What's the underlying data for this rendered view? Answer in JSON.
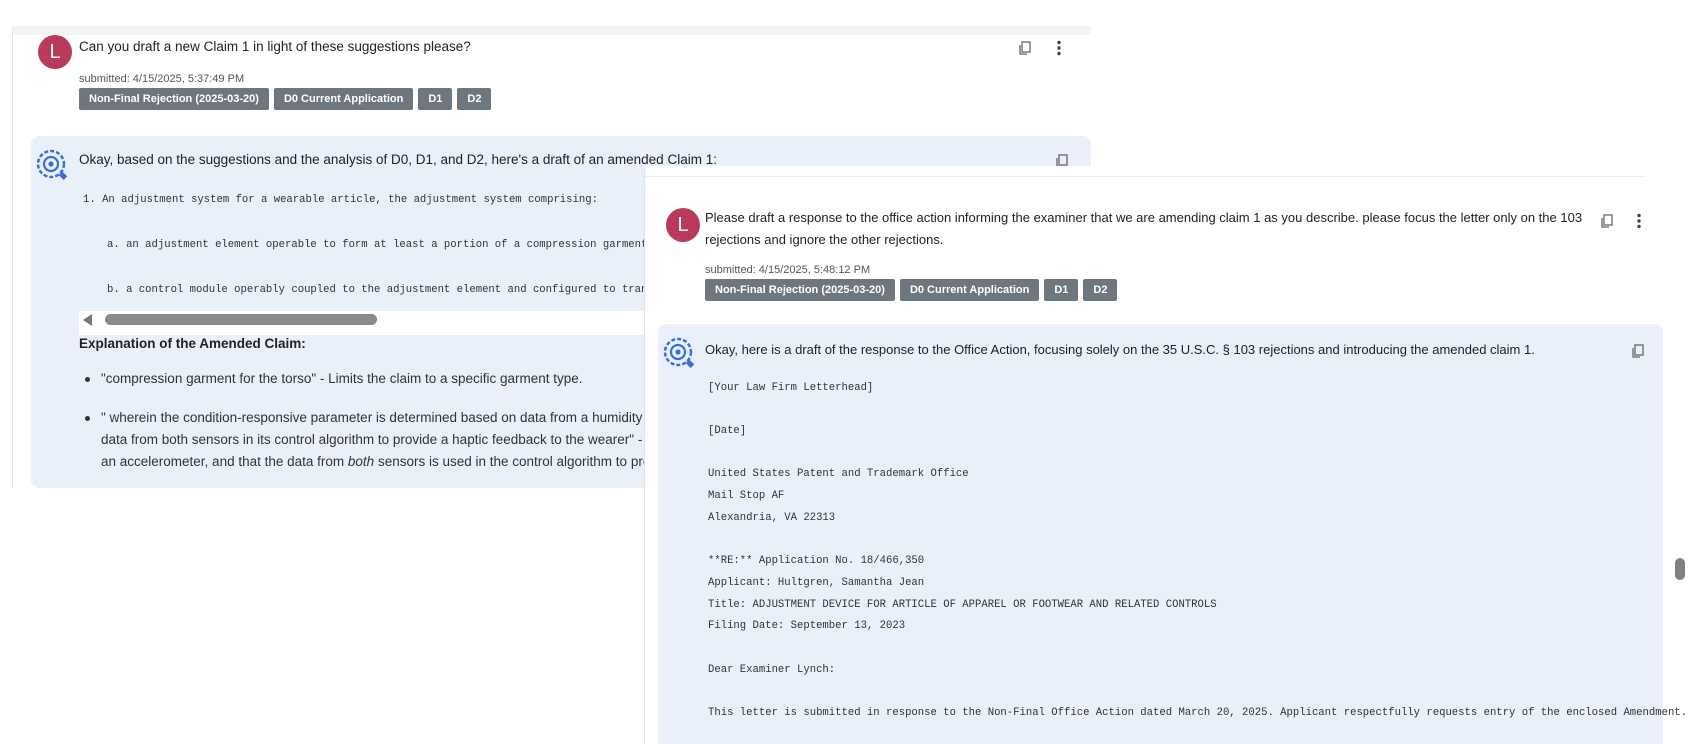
{
  "back": {
    "user_initial": "L",
    "question": "Can you draft a new Claim 1 in light of these suggestions please?",
    "submitted": "submitted: 4/15/2025, 5:37:49 PM",
    "chips": [
      "Non-Final Rejection (2025-03-20)",
      "D0 Current Application",
      "D1",
      "D2"
    ],
    "answer_lead": "Okay, based on the suggestions and the analysis of D0, D1, and D2, here's a draft of an amended Claim 1:",
    "claim_lines": [
      "1. An adjustment system for a wearable article, the adjustment system comprising:",
      "a. an adjustment element operable to form at least a portion of a compression garment fo",
      "b. a control module operably coupled to the adjustment element and configured to transla"
    ],
    "explanation_heading": "Explanation of the Amended Claim:",
    "bullet1": "\"compression garment for the torso\" - Limits the claim to a specific garment type.",
    "bullet2_line1": "\" wherein the condition-responsive parameter is determined based on data from a humidity se",
    "bullet2_line2": "data from both sensors in its control algorithm to provide a haptic feedback to the wearer\" - Fu",
    "bullet2_line3_a": "an accelerometer, and that the data from ",
    "bullet2_line3_em": "both",
    "bullet2_line3_b": " sensors is used in the control algorithm to prov"
  },
  "front": {
    "user_initial": "L",
    "question_line1": "Please draft a response to the office action informing the examiner that we are amending claim 1 as you describe. please focus the letter only on the 103",
    "question_line2": "rejections and ignore the other rejections.",
    "submitted": "submitted: 4/15/2025, 5:48:12 PM",
    "chips": [
      "Non-Final Rejection (2025-03-20)",
      "D0 Current Application",
      "D1",
      "D2"
    ],
    "answer_lead": "Okay, here is a draft of the response to the Office Action, focusing solely on the 35 U.S.C. § 103 rejections and introducing the amended claim 1.",
    "letter": {
      "letterhead": "[Your Law Firm Letterhead]",
      "date": "[Date]",
      "addr1": "United States Patent and Trademark Office",
      "addr2": "Mail Stop AF",
      "addr3": "Alexandria, VA 22313",
      "re": "**RE:** Application No. 18/466,350",
      "applicant": "Applicant: Hultgren, Samantha Jean",
      "title": "Title: ADJUSTMENT DEVICE FOR ARTICLE OF APPAREL OR FOOTWEAR AND RELATED CONTROLS",
      "filing": "Filing Date: September 13, 2023",
      "salutation": "Dear Examiner Lynch:",
      "body": "This letter is submitted in response to the Non-Final Office Action dated March 20, 2025. Applicant respectfully requests entry of the enclosed Amendment."
    }
  },
  "colors": {
    "avatar": "#b93a5b",
    "chip": "#6c7780",
    "answer_bg": "#e9f0fa",
    "bot_icon": "#3a6fd6"
  },
  "icons": [
    "copy-icon",
    "more-vertical-icon",
    "assistant-bot-icon",
    "scroll-left-arrow-icon"
  ]
}
